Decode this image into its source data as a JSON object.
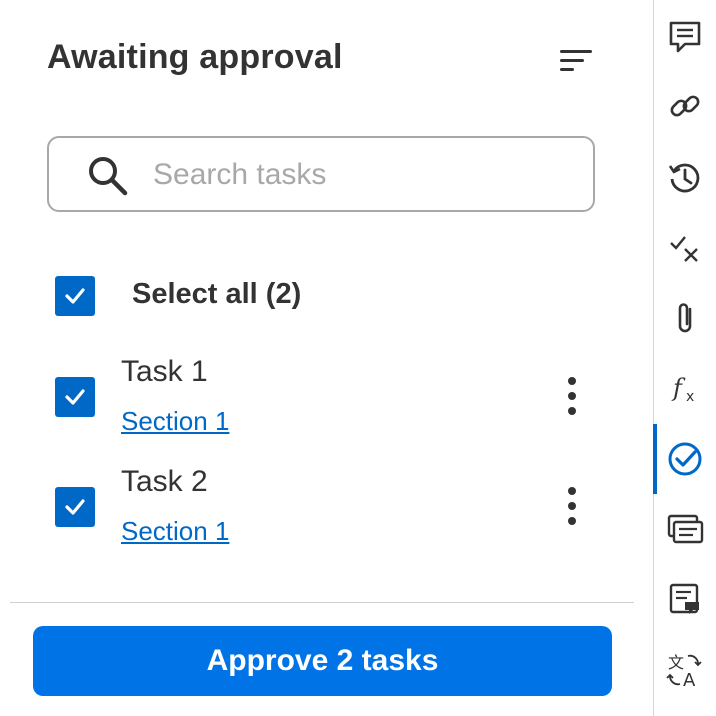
{
  "panel": {
    "title": "Awaiting approval",
    "sort_icon": "sort-lines-icon",
    "search": {
      "placeholder": "Search tasks",
      "value": "",
      "icon": "search-icon"
    },
    "select_all": {
      "label": "Select all (2)",
      "checked": true
    },
    "tasks": [
      {
        "name": "Task 1",
        "section": "Section 1",
        "checked": true
      },
      {
        "name": "Task 2",
        "section": "Section 1",
        "checked": true
      }
    ],
    "approve_button": "Approve 2 tasks"
  },
  "rail": {
    "items": [
      {
        "icon": "comment-icon"
      },
      {
        "icon": "link-icon"
      },
      {
        "icon": "history-icon"
      },
      {
        "icon": "check-cross-icon"
      },
      {
        "icon": "attachment-icon"
      },
      {
        "icon": "formula-icon"
      },
      {
        "icon": "approval-icon",
        "active": true
      },
      {
        "icon": "cards-icon"
      },
      {
        "icon": "note-icon"
      },
      {
        "icon": "translate-icon"
      }
    ]
  },
  "colors": {
    "accent": "#0069c8",
    "button": "#0073e6",
    "text": "#333333",
    "placeholder": "#a8a8a8",
    "rail_icon": "#333333"
  }
}
